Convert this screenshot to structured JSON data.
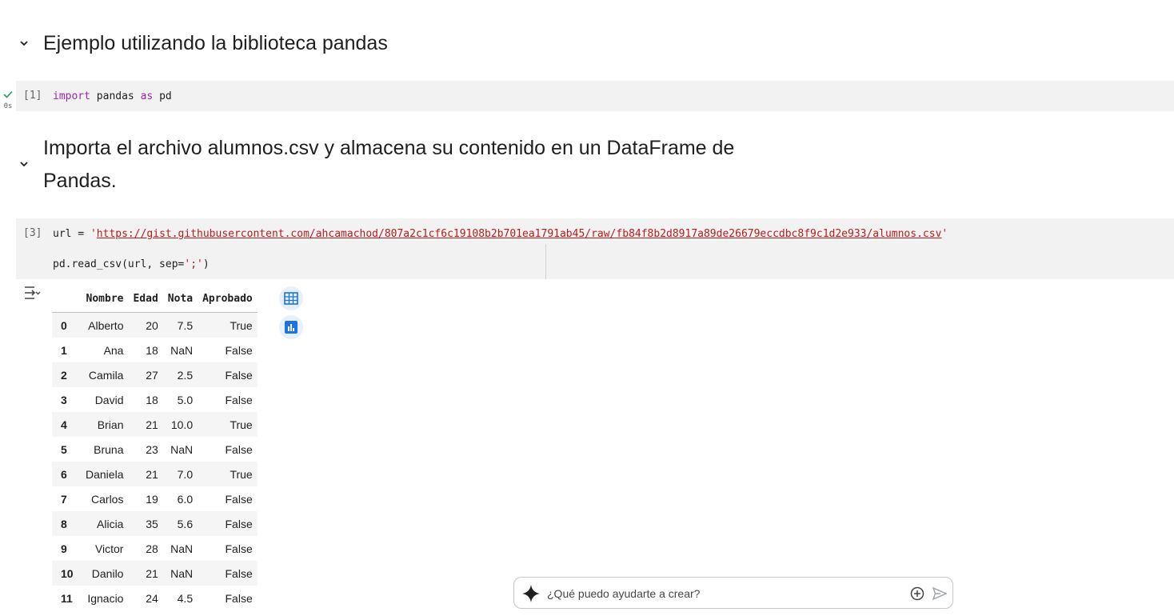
{
  "sections": [
    {
      "heading_line1": "Ejemplo utilizando la biblioteca pandas"
    },
    {
      "heading_line1": "Importa el archivo alumnos.csv y almacena su contenido en un DataFrame de",
      "heading_line2": "Pandas."
    }
  ],
  "cell1": {
    "exec_count": "[1]",
    "status_time": "0s",
    "code": {
      "kw1": "import",
      "mod": " pandas ",
      "kw2": "as",
      "alias": " pd"
    }
  },
  "cell2": {
    "exec_count": "[3]",
    "line1": {
      "prefix": "url = ",
      "quote_open": "'",
      "url": "https://gist.githubusercontent.com/ahcamachod/807a2c1cf6c19108b2b701ea1791ab45/raw/fb84f8b2d8917a89de26679eccdbc8f9c1d2e933/alumnos.csv",
      "quote_close": "'"
    },
    "line2": {
      "fn": "pd.read_csv(url, sep=",
      "arg": "';'",
      "close": ")"
    }
  },
  "dataframe": {
    "columns": [
      "Nombre",
      "Edad",
      "Nota",
      "Aprobado"
    ],
    "rows": [
      {
        "idx": "0",
        "Nombre": "Alberto",
        "Edad": "20",
        "Nota": "7.5",
        "Aprobado": "True"
      },
      {
        "idx": "1",
        "Nombre": "Ana",
        "Edad": "18",
        "Nota": "NaN",
        "Aprobado": "False"
      },
      {
        "idx": "2",
        "Nombre": "Camila",
        "Edad": "27",
        "Nota": "2.5",
        "Aprobado": "False"
      },
      {
        "idx": "3",
        "Nombre": "David",
        "Edad": "18",
        "Nota": "5.0",
        "Aprobado": "False"
      },
      {
        "idx": "4",
        "Nombre": "Brian",
        "Edad": "21",
        "Nota": "10.0",
        "Aprobado": "True"
      },
      {
        "idx": "5",
        "Nombre": "Bruna",
        "Edad": "23",
        "Nota": "NaN",
        "Aprobado": "False"
      },
      {
        "idx": "6",
        "Nombre": "Daniela",
        "Edad": "21",
        "Nota": "7.0",
        "Aprobado": "True"
      },
      {
        "idx": "7",
        "Nombre": "Carlos",
        "Edad": "19",
        "Nota": "6.0",
        "Aprobado": "False"
      },
      {
        "idx": "8",
        "Nombre": "Alicia",
        "Edad": "35",
        "Nota": "5.6",
        "Aprobado": "False"
      },
      {
        "idx": "9",
        "Nombre": "Victor",
        "Edad": "28",
        "Nota": "NaN",
        "Aprobado": "False"
      },
      {
        "idx": "10",
        "Nombre": "Danilo",
        "Edad": "21",
        "Nota": "NaN",
        "Aprobado": "False"
      },
      {
        "idx": "11",
        "Nombre": "Ignacio",
        "Edad": "24",
        "Nota": "4.5",
        "Aprobado": "False"
      }
    ]
  },
  "icons": {
    "collapse": "chevron-down-icon",
    "output_toggle": "output-toggle-icon",
    "table_view": "table-icon",
    "chart_suggest": "bar-chart-icon",
    "sparkle": "sparkle-icon",
    "add": "plus-circle-icon",
    "send": "send-icon"
  },
  "chat": {
    "placeholder": "¿Qué puedo ayudarte a crear?"
  },
  "colors": {
    "accent": "#1a73e8",
    "keyword": "#9c27b0",
    "string": "#b71c1c",
    "cell_bg": "#f2f2f2"
  }
}
